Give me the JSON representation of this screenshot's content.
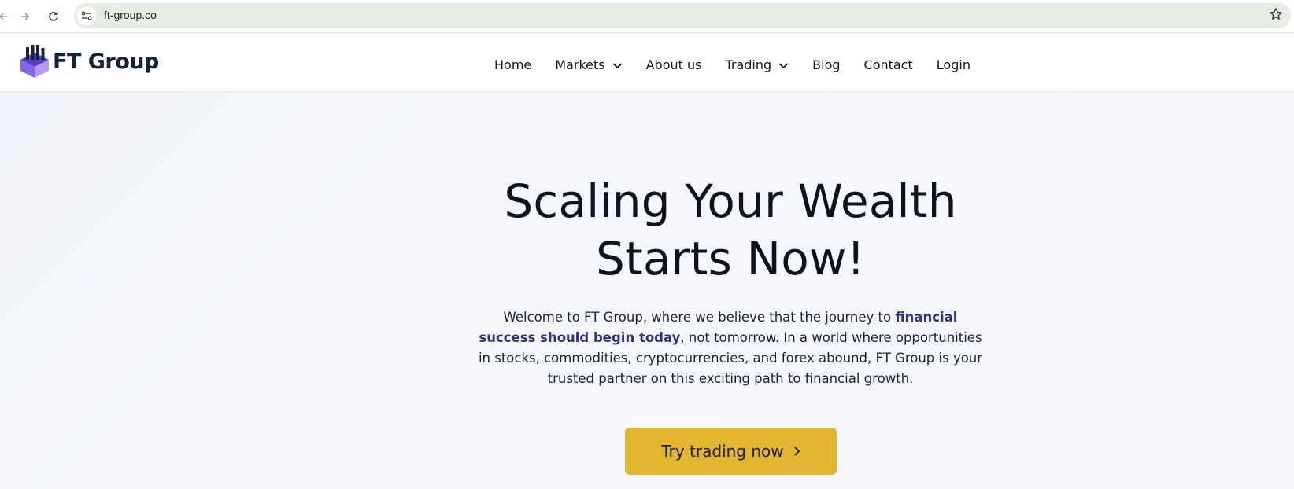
{
  "browser": {
    "url": "ft-group.co",
    "icons": [
      "back-arrow-icon",
      "forward-arrow-icon",
      "reload-icon",
      "site-info-icon",
      "bookmark-star-icon"
    ]
  },
  "header": {
    "logo_text": "FT Group",
    "logo_colors": {
      "cube_top": "#5b3fc4",
      "cube_left": "#8a63e8",
      "cube_right": "#b49af3",
      "text": "#16233f"
    },
    "nav": [
      {
        "label": "Home",
        "dropdown": false
      },
      {
        "label": "Markets",
        "dropdown": true
      },
      {
        "label": "About us",
        "dropdown": false
      },
      {
        "label": "Trading",
        "dropdown": true
      },
      {
        "label": "Blog",
        "dropdown": false
      },
      {
        "label": "Contact",
        "dropdown": false
      },
      {
        "label": "Login",
        "dropdown": false
      }
    ]
  },
  "hero": {
    "title_line1": "Scaling Your Wealth",
    "title_line2": "Starts Now!",
    "text_part1": "Welcome to FT Group, where we believe that the journey to ",
    "text_highlight": "financial success should begin today",
    "text_part2": ", not tomorrow. In a world where opportunities in stocks, commodities, cryptocurrencies, and forex abound, FT Group is your trusted partner on this exciting path to financial growth.",
    "highlight_color": "#2f2f86",
    "cta_label": "Try trading now",
    "cta_color": "#e2b72f"
  }
}
